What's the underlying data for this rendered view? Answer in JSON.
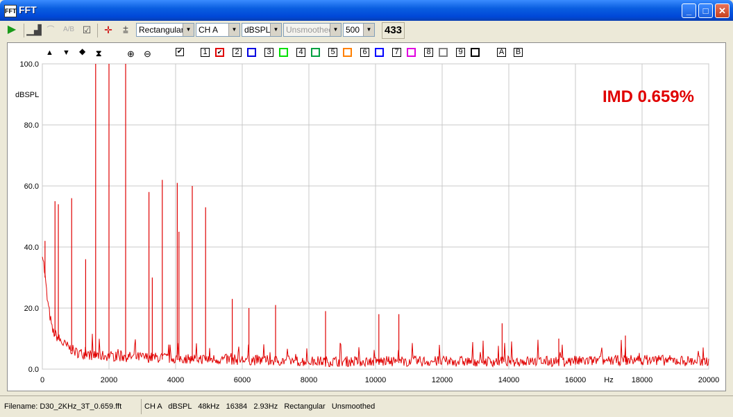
{
  "window": {
    "title": "FFT",
    "app_icon_label": "FFT"
  },
  "toolbar": {
    "window_type": "Rectangular",
    "channel": "CH A",
    "units": "dBSPL",
    "smoothing": "Unsmoothed",
    "average_count": "500",
    "counter": "433"
  },
  "plot_controls": {
    "channel_numbers": [
      "1",
      "2",
      "3",
      "4",
      "5",
      "6",
      "7",
      "8",
      "9"
    ],
    "channel_colors": [
      "#E00000",
      "#0000E0",
      "#00C000",
      "#00A040",
      "#FF8000",
      "#0000FF",
      "#E000E0",
      "#808080",
      "#000000"
    ],
    "channel1_checked": true,
    "marker_a": "A",
    "marker_b": "B"
  },
  "overlay": {
    "label": "IMD 0.659%",
    "color": "#E00000"
  },
  "chart_data": {
    "type": "line",
    "title": "",
    "xlabel": "Hz",
    "ylabel": "dBSPL",
    "xlim": [
      0,
      20000
    ],
    "ylim": [
      0,
      100
    ],
    "x_ticks": [
      "0",
      "2000",
      "4000",
      "6000",
      "8000",
      "10000",
      "12000",
      "14000",
      "16000",
      "18000",
      "20000"
    ],
    "y_ticks": [
      "0.0",
      "20.0",
      "40.0",
      "60.0",
      "80.0",
      "100.0"
    ],
    "grid": true,
    "series_color": "#E00000",
    "noise_floor": [
      [
        0,
        38
      ],
      [
        80,
        30
      ],
      [
        150,
        22
      ],
      [
        300,
        12
      ],
      [
        600,
        8
      ],
      [
        1000,
        5
      ],
      [
        1500,
        4
      ],
      [
        2500,
        3.5
      ],
      [
        4000,
        3
      ],
      [
        6000,
        2.5
      ],
      [
        8000,
        2
      ],
      [
        10000,
        2
      ],
      [
        13000,
        2
      ],
      [
        16000,
        2
      ],
      [
        18000,
        2.5
      ],
      [
        20000,
        2
      ]
    ],
    "peaks": [
      {
        "x": 80,
        "y": 42
      },
      {
        "x": 380,
        "y": 55
      },
      {
        "x": 480,
        "y": 54
      },
      {
        "x": 880,
        "y": 56
      },
      {
        "x": 1600,
        "y": 100
      },
      {
        "x": 2000,
        "y": 100
      },
      {
        "x": 2500,
        "y": 100
      },
      {
        "x": 1300,
        "y": 36
      },
      {
        "x": 3200,
        "y": 58
      },
      {
        "x": 3600,
        "y": 62
      },
      {
        "x": 3300,
        "y": 30
      },
      {
        "x": 4050,
        "y": 61
      },
      {
        "x": 4100,
        "y": 45
      },
      {
        "x": 4500,
        "y": 60
      },
      {
        "x": 4900,
        "y": 53
      },
      {
        "x": 5700,
        "y": 23
      },
      {
        "x": 6200,
        "y": 20
      },
      {
        "x": 7000,
        "y": 21
      },
      {
        "x": 8500,
        "y": 19
      },
      {
        "x": 10100,
        "y": 18
      },
      {
        "x": 10700,
        "y": 18
      },
      {
        "x": 13800,
        "y": 15
      },
      {
        "x": 15500,
        "y": 10
      },
      {
        "x": 17500,
        "y": 11
      }
    ]
  },
  "status": {
    "filename": "Filename: D30_2KHz_3T_0.659.fft",
    "info": "CH A   dBSPL   48kHz   16384   2.93Hz   Rectangular   Unsmoothed"
  }
}
